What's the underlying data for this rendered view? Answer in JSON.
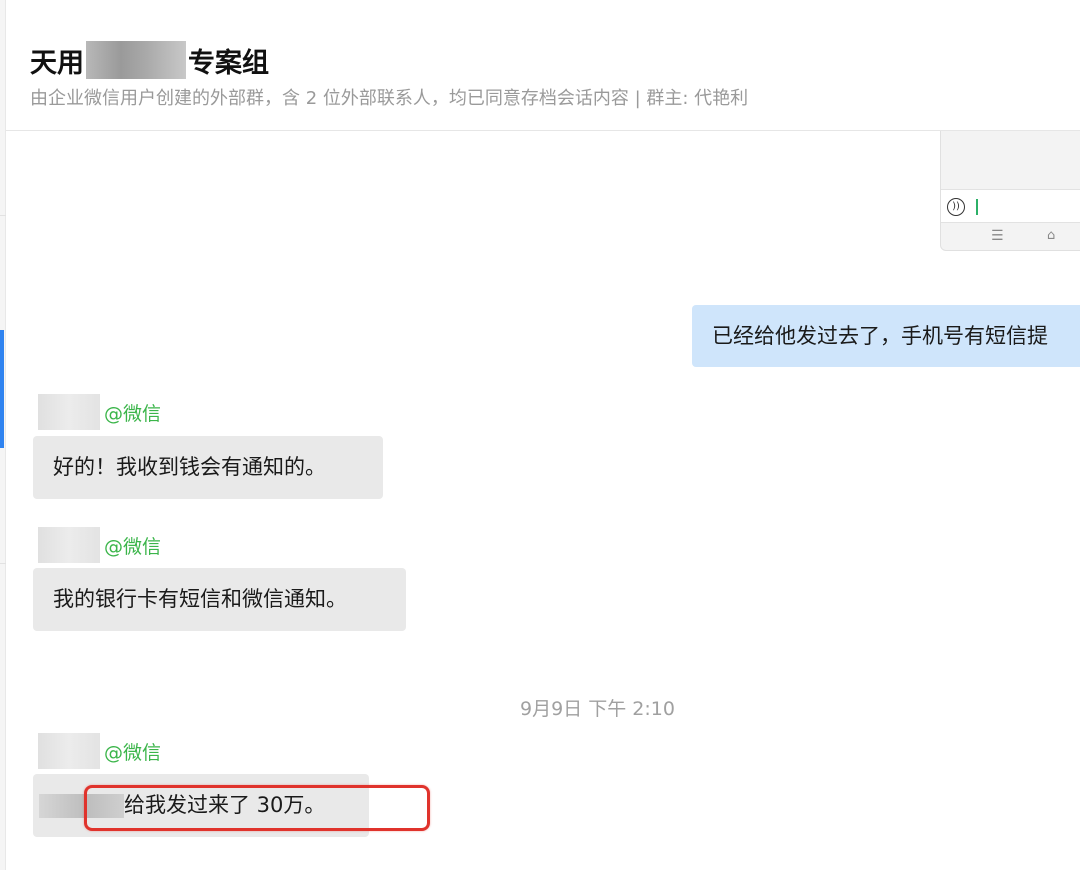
{
  "header": {
    "title_prefix": "天用",
    "title_suffix": "专案组",
    "subtitle": "由企业微信用户创建的外部群，含 2 位外部联系人，均已同意存档会话内容 | 群主: 代艳利"
  },
  "messages": {
    "outgoing_1": "已经给他发过去了，手机号有短信提",
    "incoming_1": {
      "tag": "@微信",
      "text": "好的！我收到钱会有通知的。"
    },
    "incoming_2": {
      "tag": "@微信",
      "text": "我的银行卡有短信和微信通知。"
    },
    "timestamp": "9月9日 下午 2:10",
    "incoming_3": {
      "tag": "@微信",
      "text": "给我发过来了 30万。"
    }
  },
  "colors": {
    "outgoing_bubble": "#cfe5fb",
    "incoming_bubble": "#e9e9e9",
    "wechat_tag": "#3bb54a",
    "highlight": "#e0332c",
    "sidebar_active": "#2f83f0"
  },
  "icons": {
    "voice": "voice-icon",
    "menu": "menu-icon",
    "home": "home-icon"
  }
}
